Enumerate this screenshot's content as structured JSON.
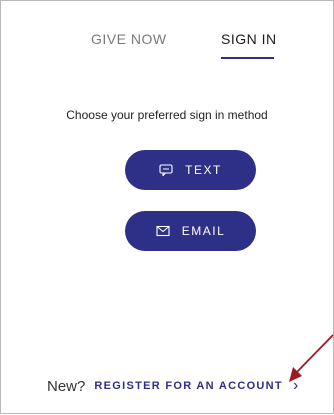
{
  "tabs": {
    "give_now": "GIVE NOW",
    "sign_in": "SIGN IN"
  },
  "prompt": "Choose your preferred sign in method",
  "buttons": {
    "text": {
      "label": "TEXT",
      "icon": "message-icon"
    },
    "email": {
      "label": "EMAIL",
      "icon": "mail-icon"
    }
  },
  "footer": {
    "new_label": "New?",
    "register_label": "REGISTER FOR AN ACCOUNT",
    "chevron": "›"
  },
  "colors": {
    "brand": "#2e2f86",
    "annotation_arrow": "#9c1b23"
  }
}
